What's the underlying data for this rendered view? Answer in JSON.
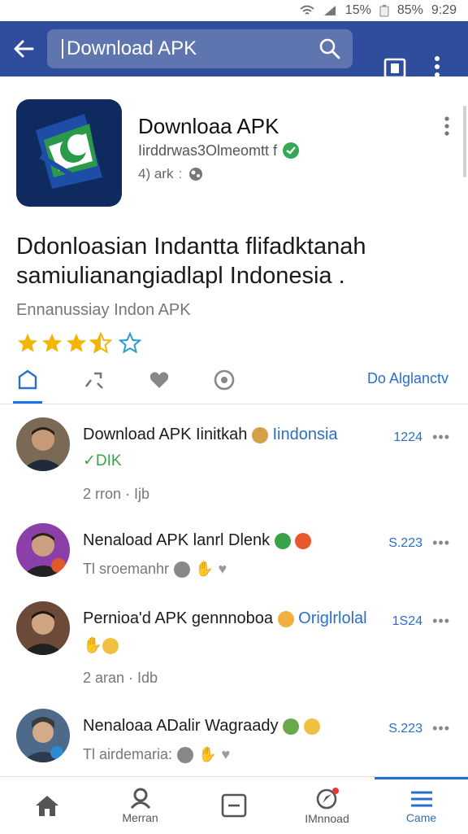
{
  "status_bar": {
    "battery": "85%",
    "signal_text": "15%",
    "time": "9:29"
  },
  "search": {
    "value": "Download APK"
  },
  "app": {
    "title": "Downloaa APK",
    "developer": "Iirddrwas3Olmeomtt f",
    "meta": "4) ark",
    "icon_name": "app-logo-icon"
  },
  "headline": "Ddonloasian Indantta flifadktanah samiulianangiadlapl Indonesia .",
  "subline": "Ennanussiay Indon APK",
  "rating": {
    "stars": 3.5,
    "max": 5
  },
  "tabs": {
    "right_label": "Do Alglanctv"
  },
  "posts": [
    {
      "title": "Download APK Iinitkah",
      "title_tail": "Iindonsia",
      "sub": "DIK",
      "meta": "2 rron · Ijb",
      "count": "1224",
      "avatar_color": "#7a6a55"
    },
    {
      "title": "Nenaload APK lanrl Dlenk",
      "title_tail": "",
      "sub": "",
      "meta": "Tl sroemanhr",
      "count": "S.223",
      "avatar_color": "#8b3fa8"
    },
    {
      "title": "Pernioa'd APK gennnoboa",
      "title_tail": "Origlrlolal",
      "sub": "",
      "meta": "2 aran · Idb",
      "count": "1S24",
      "avatar_color": "#6b4a3a"
    },
    {
      "title": "Nenaloaa ADalir Wagraady",
      "title_tail": "",
      "sub": "",
      "meta": "Tl airdemaria:",
      "count": "S.223",
      "avatar_color": "#4d6a8a"
    }
  ],
  "bottom_nav": [
    {
      "label": "",
      "icon": "home-icon"
    },
    {
      "label": "Merran",
      "icon": "person-icon"
    },
    {
      "label": "",
      "icon": "inbox-icon"
    },
    {
      "label": "IMnnoad",
      "icon": "compass-icon"
    },
    {
      "label": "Came",
      "icon": "menu-icon"
    }
  ],
  "colors": {
    "appbar": "#2f4d9c",
    "accent": "#2a6fc9",
    "star": "#f4b400"
  }
}
